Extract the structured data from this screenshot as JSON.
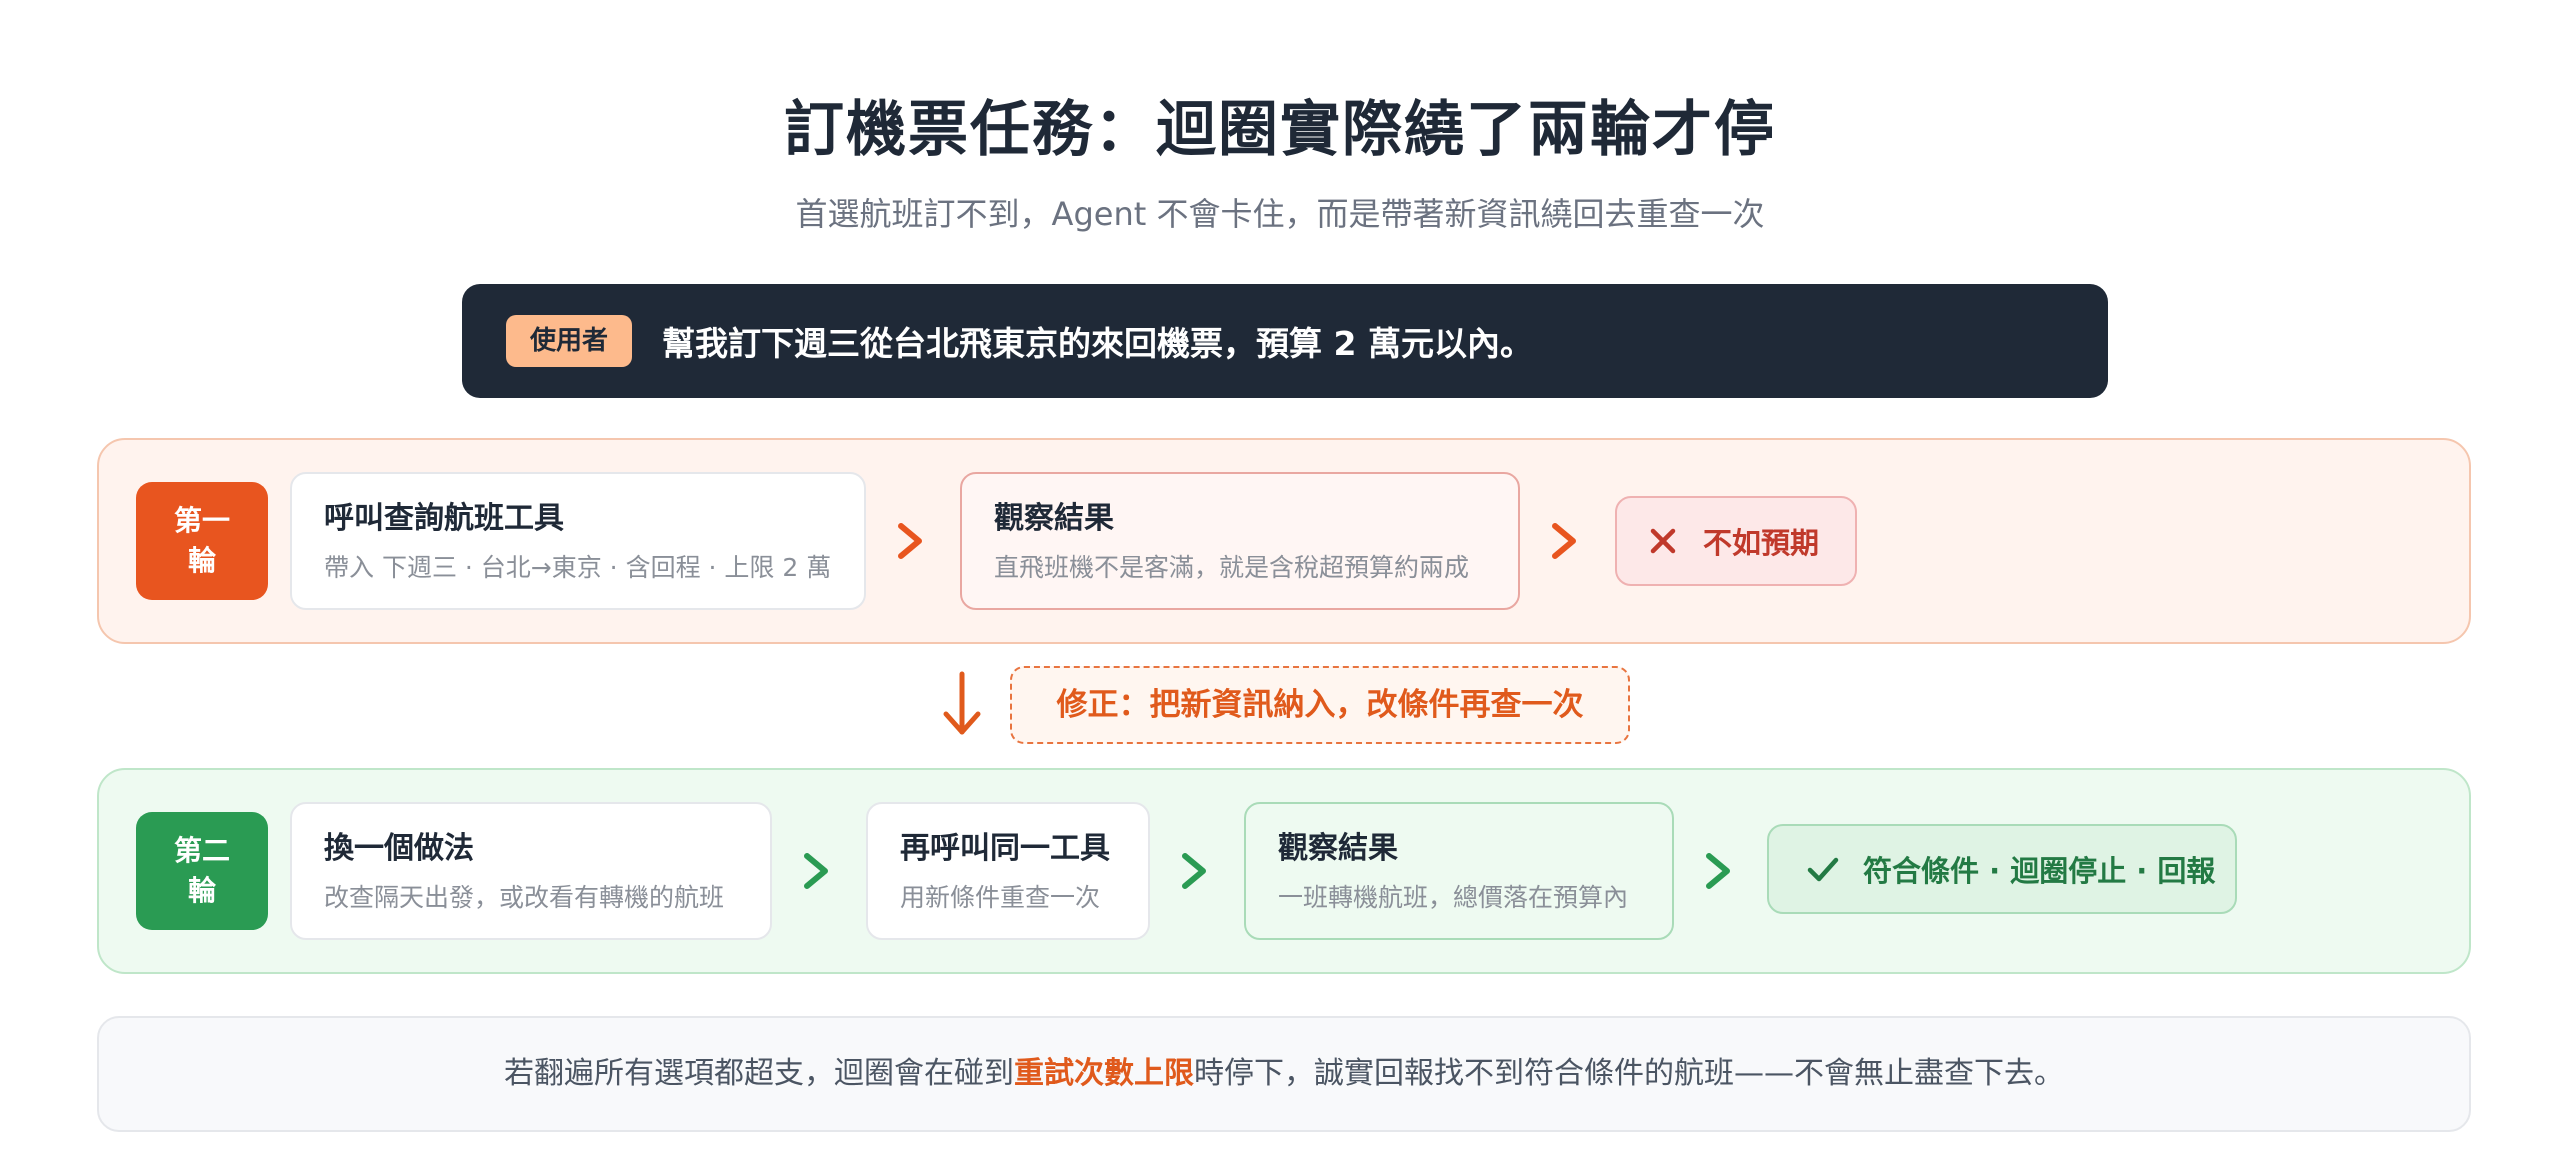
{
  "title": "訂機票任務：迴圈實際繞了兩輪才停",
  "subtitle": "首選航班訂不到，Agent 不會卡住，而是帶著新資訊繞回去重查一次",
  "user": {
    "tag": "使用者",
    "text": "幫我訂下週三從台北飛東京的來回機票，預算 2 萬元以內。"
  },
  "round1": {
    "badge_line1": "第一",
    "badge_line2": "輪",
    "step1": {
      "title": "呼叫查詢航班工具",
      "detail": "帶入 下週三 · 台北→東京 · 含回程 · 上限 2 萬"
    },
    "step2": {
      "title": "觀察結果",
      "detail": "直飛班機不是客滿，就是含稅超預算約兩成"
    },
    "result": "不如預期",
    "result_icon": "close-icon",
    "accent": "#e8551f"
  },
  "fix": {
    "text": "修正：把新資訊納入，改條件再查一次"
  },
  "round2": {
    "badge_line1": "第二",
    "badge_line2": "輪",
    "step1": {
      "title": "換一個做法",
      "detail": "改查隔天出發，或改看有轉機的航班"
    },
    "step2": {
      "title": "再呼叫同一工具",
      "detail": "用新條件重查一次"
    },
    "step3": {
      "title": "觀察結果",
      "detail": "一班轉機航班，總價落在預算內"
    },
    "result": "符合條件 · 迴圈停止 · 回報",
    "result_icon": "check-icon",
    "accent": "#2a9b53"
  },
  "note": {
    "before": "若翻遍所有選項都超支，迴圈會在碰到",
    "highlight": "重試次數上限",
    "after": "時停下，誠實回報找不到符合條件的航班——不會無止盡查下去。"
  }
}
